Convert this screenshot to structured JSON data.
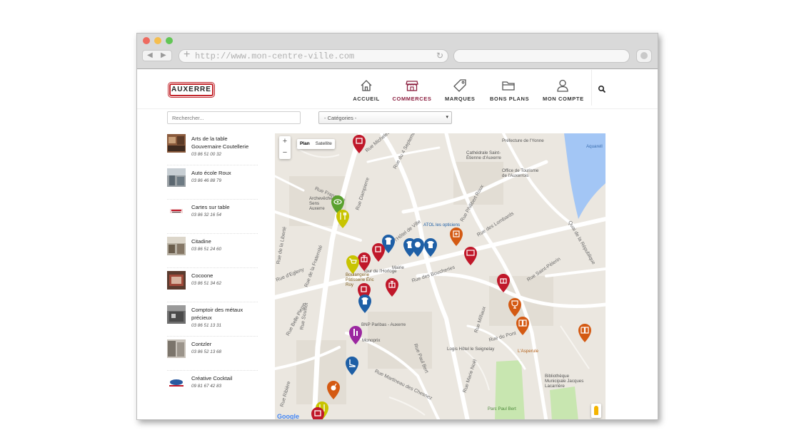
{
  "browser": {
    "url": "http://www.mon-centre-ville.com",
    "back_glyph": "◀",
    "forward_glyph": "▶",
    "new_tab_glyph": "+",
    "reload_glyph": "↻"
  },
  "header": {
    "logo_text": "AUXERRE",
    "nav": [
      {
        "label": "ACCUEIL",
        "icon": "home-icon",
        "active": false
      },
      {
        "label": "COMMERCES",
        "icon": "store-icon",
        "active": true
      },
      {
        "label": "MARQUES",
        "icon": "tag-icon",
        "active": false
      },
      {
        "label": "BONS PLANS",
        "icon": "folder-icon",
        "active": false
      },
      {
        "label": "MON COMPTE",
        "icon": "user-icon",
        "active": false
      }
    ],
    "search_icon": "search-icon",
    "active_color": "#8b1e3f"
  },
  "filters": {
    "search_placeholder": "Rechercher...",
    "category_value": "- Catégories -",
    "caret": "▾"
  },
  "shops": [
    {
      "name": "Arts de la table Gouvernaire Coutellerie",
      "phone": "03 86 51 00 32"
    },
    {
      "name": "Auto école Roux",
      "phone": "03 86 46 88 79"
    },
    {
      "name": "Cartes sur table",
      "phone": "03 86 32 16 54"
    },
    {
      "name": "Citadine",
      "phone": "03 86 51 24 60"
    },
    {
      "name": "Cocoone",
      "phone": "03 86 51 34 62"
    },
    {
      "name": "Comptoir des métaux précieux",
      "phone": "03 86 51 13 31"
    },
    {
      "name": "Contzler",
      "phone": "03 86 52 13 68"
    },
    {
      "name": "Créative Cocktail",
      "phone": "09 81 67 42 83"
    }
  ],
  "map": {
    "zoom_in": "+",
    "zoom_out": "−",
    "type_plan": "Plan",
    "type_satellite": "Satellite",
    "attribution": "Google",
    "water_color": "#a3c6f5",
    "park_color": "#c8e6b0",
    "labels": [
      "Préfecture de l'Yonne",
      "Cathédrale Saint-Étienne d'Auxerre",
      "Office de Tourisme de l'Auxerrois",
      "Archevêché Sens Auxerre",
      "ATOL les opticiens",
      "Boulangerie Pâtisserie Éric Roy",
      "Tour de l'Horloge",
      "Mairie",
      "BNP Paribas - Auxerre",
      "Monoprix",
      "Logis Hôtel le Seignelay",
      "L'Asperule",
      "Bibliothèque Municipale Jacques Lacarrière",
      "Parc Paul Bert",
      "Aquarell"
    ],
    "streets": [
      "Rue du 4 Septembre",
      "Rue Dampierre",
      "Rue Française",
      "Rue d'Egleny",
      "Rue de la Liberté",
      "Rue Philibert Roux",
      "Rue des Lombards",
      "Rue Saint-Pèlerin",
      "Quai de la République",
      "Rue du Pont",
      "Rue Paul Bert",
      "Rue Marie Noël",
      "Rue Milliaux",
      "Rue Michelet",
      "Place de l'Hôtel de Ville",
      "Rue des Boucheries",
      "Rue de la Fraternité",
      "Rue Belle Pierre",
      "Rue Martineau des Chesnez",
      "Rue Soufflot",
      "Rue Ribière"
    ],
    "pins": [
      {
        "color": "#c0182a",
        "icon": "crop-icon"
      },
      {
        "color": "#5aa12f",
        "icon": "eye-icon"
      },
      {
        "color": "#c8c400",
        "icon": "cutlery-icon"
      },
      {
        "color": "#1e5fa6",
        "icon": "shirt-icon"
      },
      {
        "color": "#1e5fa6",
        "icon": "shirt-icon"
      },
      {
        "color": "#1e5fa6",
        "icon": "shirt-icon"
      },
      {
        "color": "#1e5fa6",
        "icon": "shirt-icon"
      },
      {
        "color": "#c0182a",
        "icon": "tag-icon"
      },
      {
        "color": "#c0182a",
        "icon": "gift-icon"
      },
      {
        "color": "#c8c400",
        "icon": "cart-icon"
      },
      {
        "color": "#d45a13",
        "icon": "medical-icon"
      },
      {
        "color": "#c0182a",
        "icon": "screen-icon"
      },
      {
        "color": "#c0182a",
        "icon": "gift-icon"
      },
      {
        "color": "#c0182a",
        "icon": "tag-icon"
      },
      {
        "color": "#1e5fa6",
        "icon": "shirt-icon"
      },
      {
        "color": "#9b27a0",
        "icon": "cosmetics-icon"
      },
      {
        "color": "#1e5fa6",
        "icon": "shoe-icon"
      },
      {
        "color": "#d45a13",
        "icon": "trophy-icon"
      },
      {
        "color": "#d45a13",
        "icon": "book-icon"
      },
      {
        "color": "#d45a13",
        "icon": "book-icon"
      },
      {
        "color": "#d45a13",
        "icon": "bomb-icon"
      },
      {
        "color": "#c8c400",
        "icon": "cutlery-icon"
      },
      {
        "color": "#c0182a",
        "icon": "crop-icon"
      }
    ]
  }
}
